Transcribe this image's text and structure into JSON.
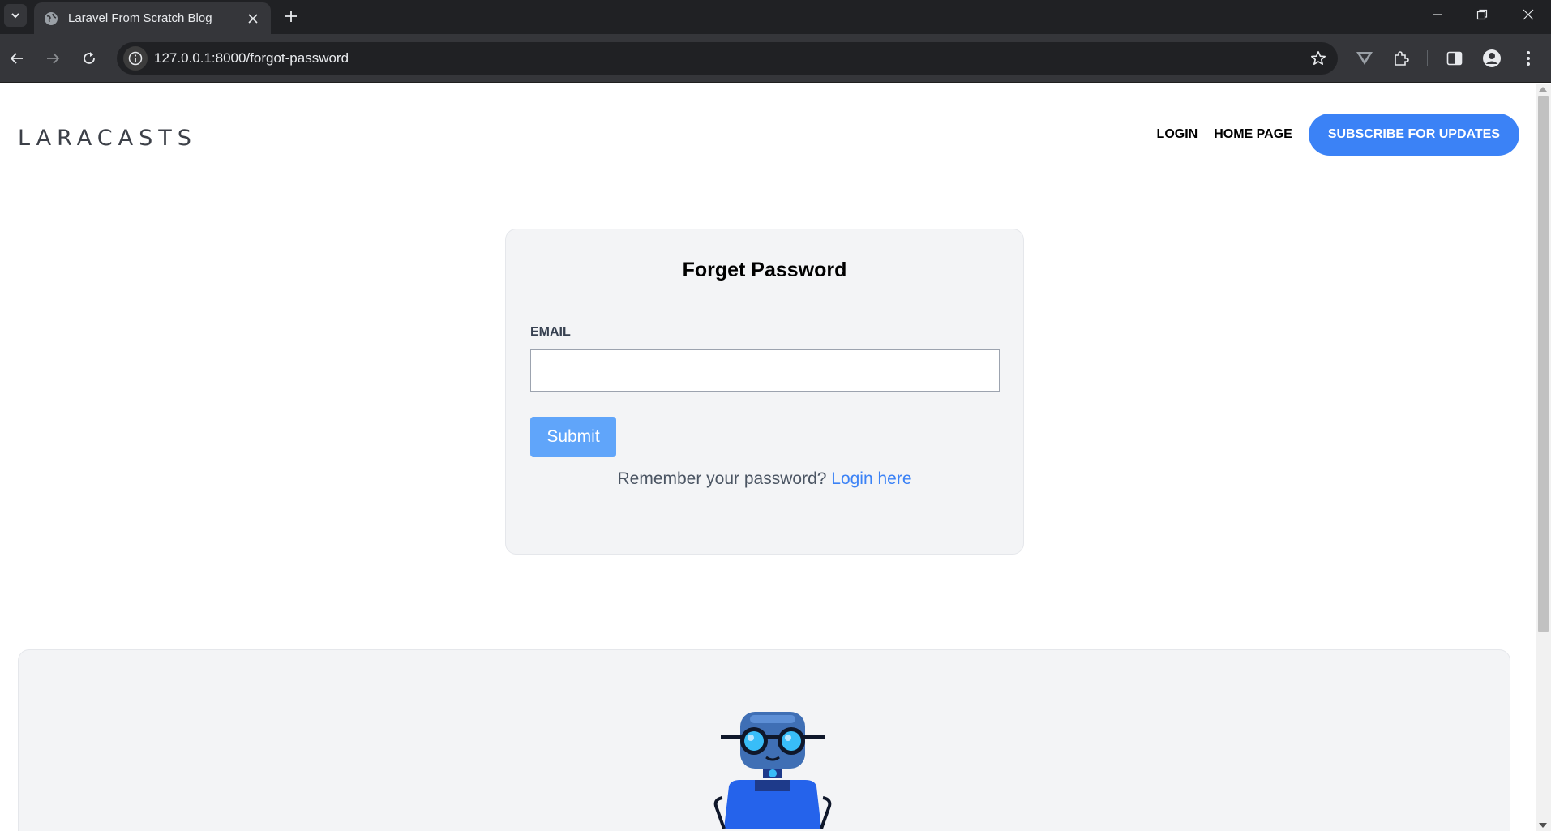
{
  "browser": {
    "tab_title": "Laravel From Scratch Blog",
    "url": "127.0.0.1:8000/forgot-password"
  },
  "header": {
    "logo_text": "LARACASTS",
    "nav": {
      "login": "LOGIN",
      "home": "HOME PAGE",
      "subscribe": "SUBSCRIBE FOR UPDATES"
    }
  },
  "form": {
    "title": "Forget Password",
    "email_label": "EMAIL",
    "email_value": "",
    "submit_label": "Submit",
    "remember_text": "Remember your password?",
    "login_link": "Login here"
  },
  "colors": {
    "accent": "#3b82f6",
    "submit_bg": "#60a5fa",
    "card_bg": "#f3f4f6"
  },
  "icons": [
    "tab-search-icon",
    "globe-icon",
    "close-icon",
    "plus-icon",
    "minimize-icon",
    "restore-icon",
    "back-icon",
    "forward-icon",
    "reload-icon",
    "info-icon",
    "star-icon",
    "vivaldi-icon",
    "extensions-icon",
    "side-panel-icon",
    "profile-icon",
    "more-icon",
    "robot-mascot"
  ]
}
